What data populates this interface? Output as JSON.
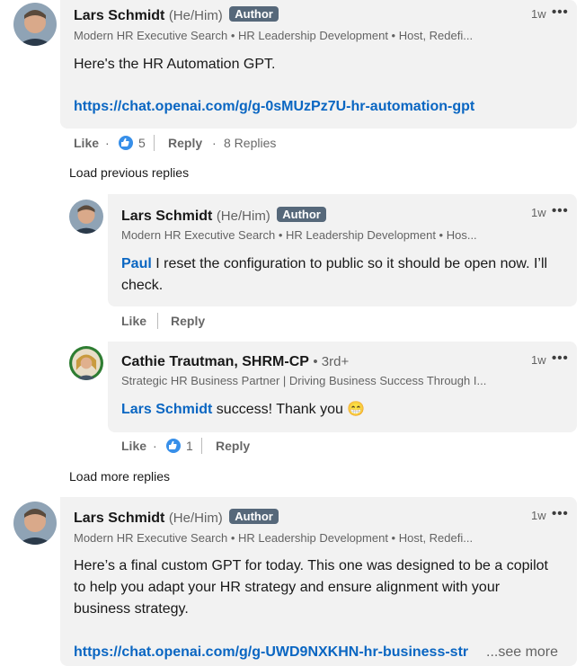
{
  "comments": [
    {
      "author": "Lars Schmidt",
      "pronouns": "(He/Him)",
      "badge": "Author",
      "headline": "Modern HR Executive Search • HR Leadership Development • Host, Redefi...",
      "time": "1w",
      "text": "Here's the HR Automation GPT.",
      "link": "https://chat.openai.com/g/g-0sMUzPz7U-hr-automation-gpt",
      "like_label": "Like",
      "like_count": "5",
      "reply_label": "Reply",
      "replies_count": "8 Replies"
    },
    {
      "author": "Lars Schmidt",
      "pronouns": "(He/Him)",
      "badge": "Author",
      "headline": "Modern HR Executive Search • HR Leadership Development • Hos...",
      "time": "1w",
      "mention": "Paul",
      "text": " I reset the configuration to public so it should be open now. I’ll check.",
      "like_label": "Like",
      "reply_label": "Reply"
    },
    {
      "author": "Cathie Trautman, SHRM-CP",
      "degree": "• 3rd+",
      "headline": "Strategic HR Business Partner | Driving Business Success Through I...",
      "time": "1w",
      "mention": "Lars Schmidt",
      "text": " success! Thank you 😁",
      "like_label": "Like",
      "like_count": "1",
      "reply_label": "Reply"
    },
    {
      "author": "Lars Schmidt",
      "pronouns": "(He/Him)",
      "badge": "Author",
      "headline": "Modern HR Executive Search • HR Leadership Development • Host, Redefi...",
      "time": "1w",
      "text": "Here’s a final custom GPT for today. This one was designed to be a copilot to help you adapt your HR strategy and ensure alignment with your business strategy.",
      "link": "https://chat.openai.com/g/g-UWD9NXKHN-hr-business-str",
      "see_more": "...see more"
    }
  ],
  "load_previous": "Load previous replies",
  "load_more": "Load more replies",
  "dots": "•••",
  "separator_dot": "·"
}
